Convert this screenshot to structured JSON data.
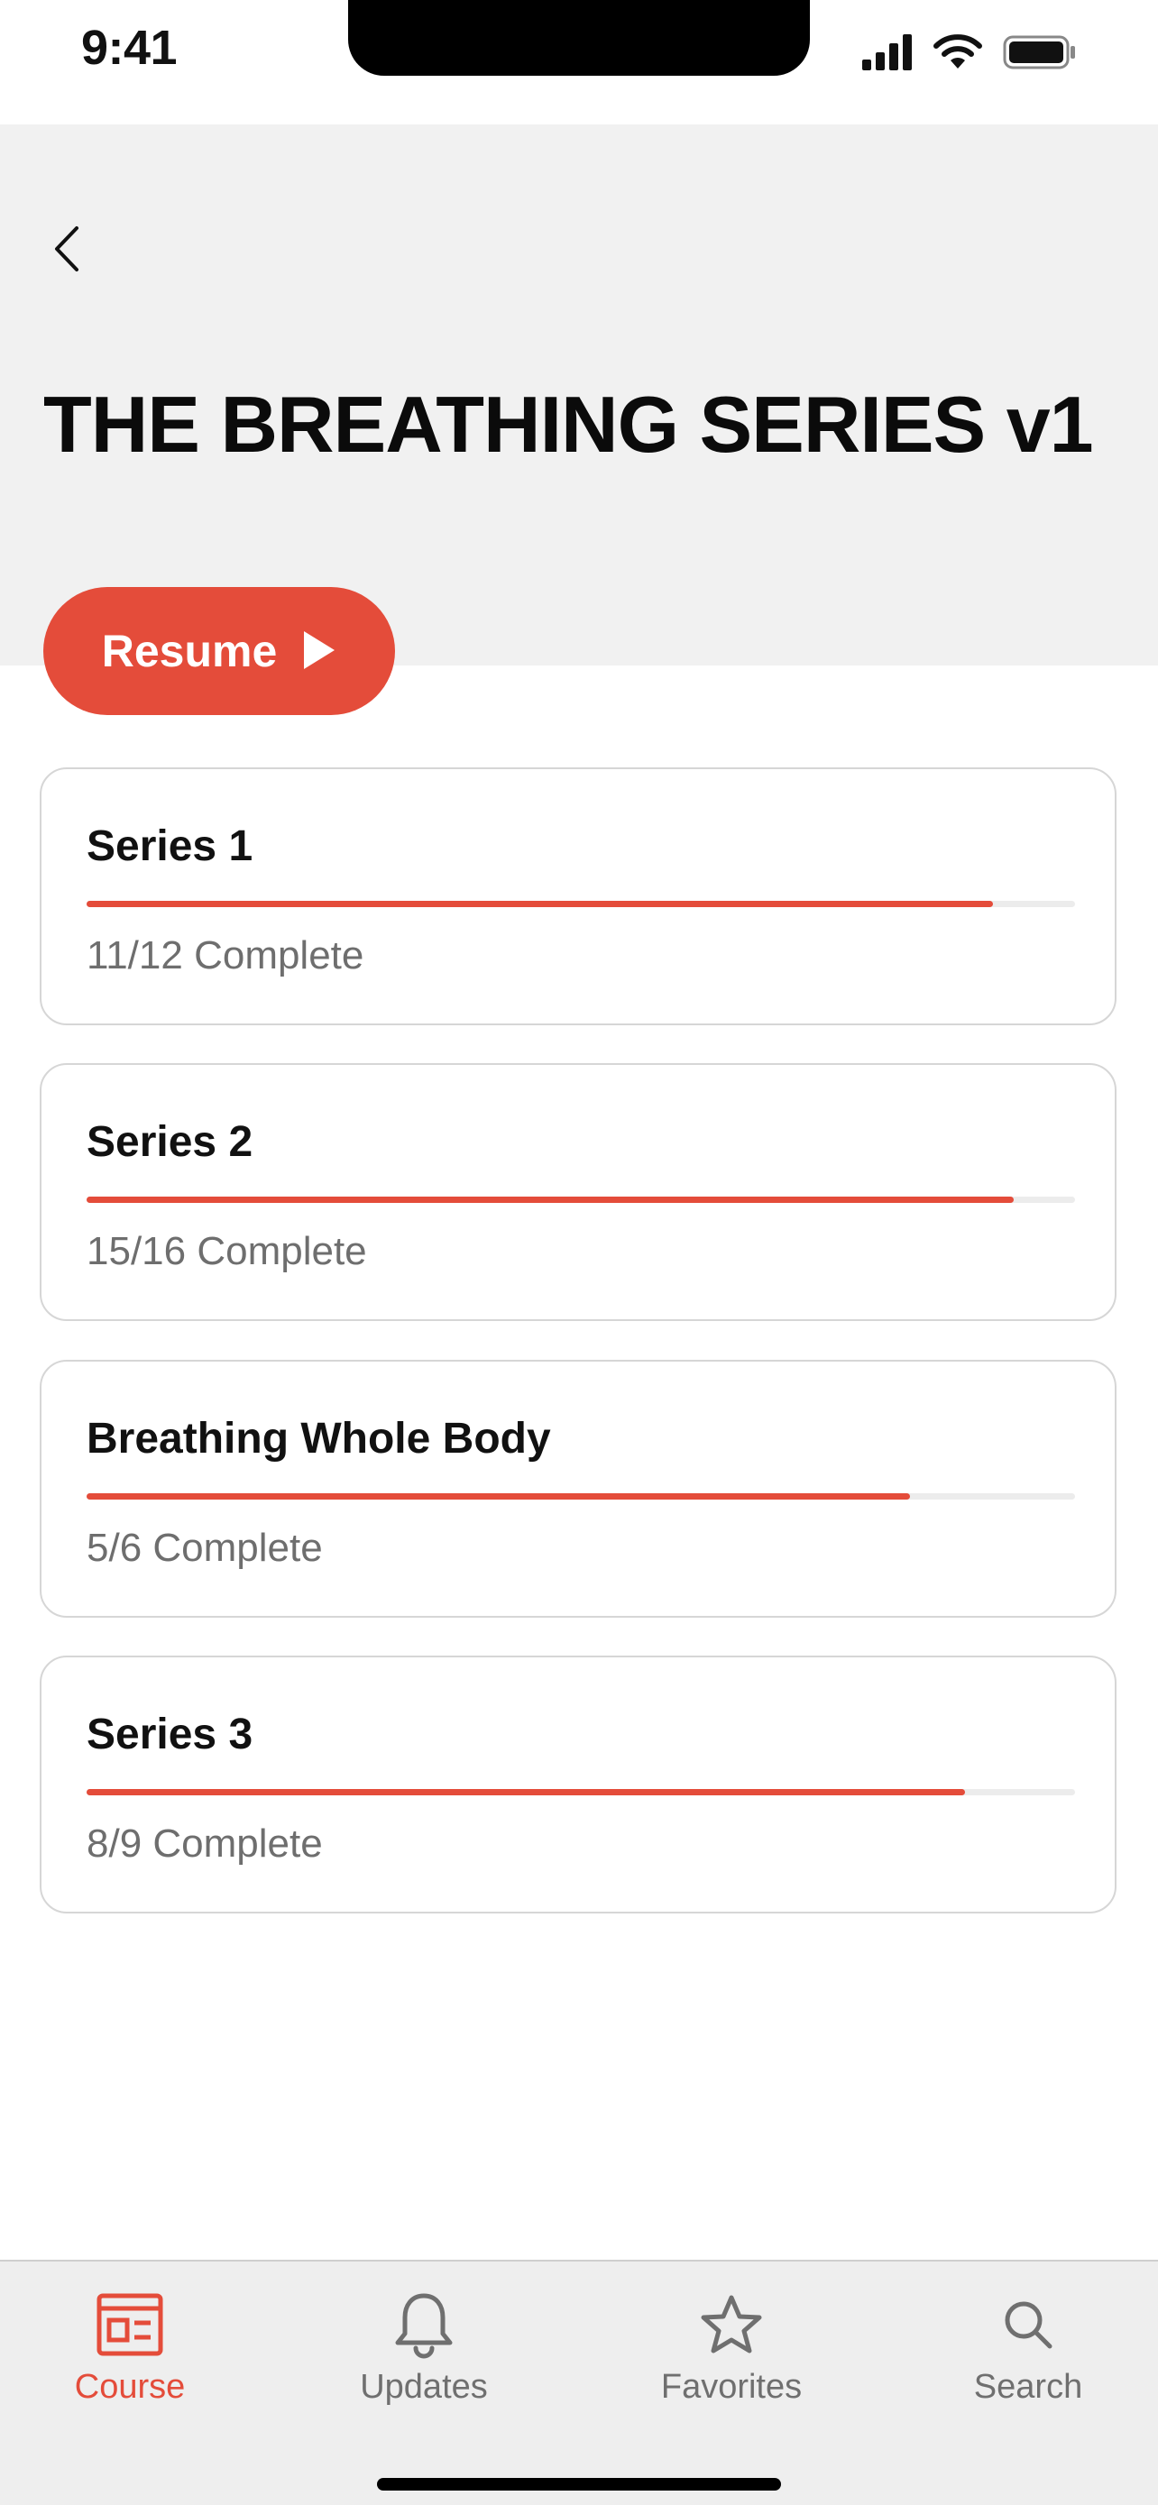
{
  "status_bar": {
    "time": "9:41"
  },
  "header": {
    "title": "THE BREATHING SERIES v1",
    "back_icon": "chevron-left-icon"
  },
  "resume_button": {
    "label": "Resume",
    "icon": "play-icon"
  },
  "series": [
    {
      "title": "Series 1",
      "status": "11/12 Complete",
      "progress": 0.917
    },
    {
      "title": "Series 2",
      "status": "15/16 Complete",
      "progress": 0.9375
    },
    {
      "title": "Breathing Whole Body",
      "status": "5/6 Complete",
      "progress": 0.833
    },
    {
      "title": "Series 3",
      "status": "8/9 Complete",
      "progress": 0.889
    }
  ],
  "tab_bar": {
    "tabs": [
      {
        "label": "Course",
        "icon": "course-icon",
        "active": true
      },
      {
        "label": "Updates",
        "icon": "bell-icon",
        "active": false
      },
      {
        "label": "Favorites",
        "icon": "star-icon",
        "active": false
      },
      {
        "label": "Search",
        "icon": "search-icon",
        "active": false
      }
    ]
  },
  "colors": {
    "accent": "#e44c3a",
    "header_bg": "#f1f1f1",
    "tab_bar_bg": "#eeeeee",
    "muted_text": "#6e6e6e"
  }
}
